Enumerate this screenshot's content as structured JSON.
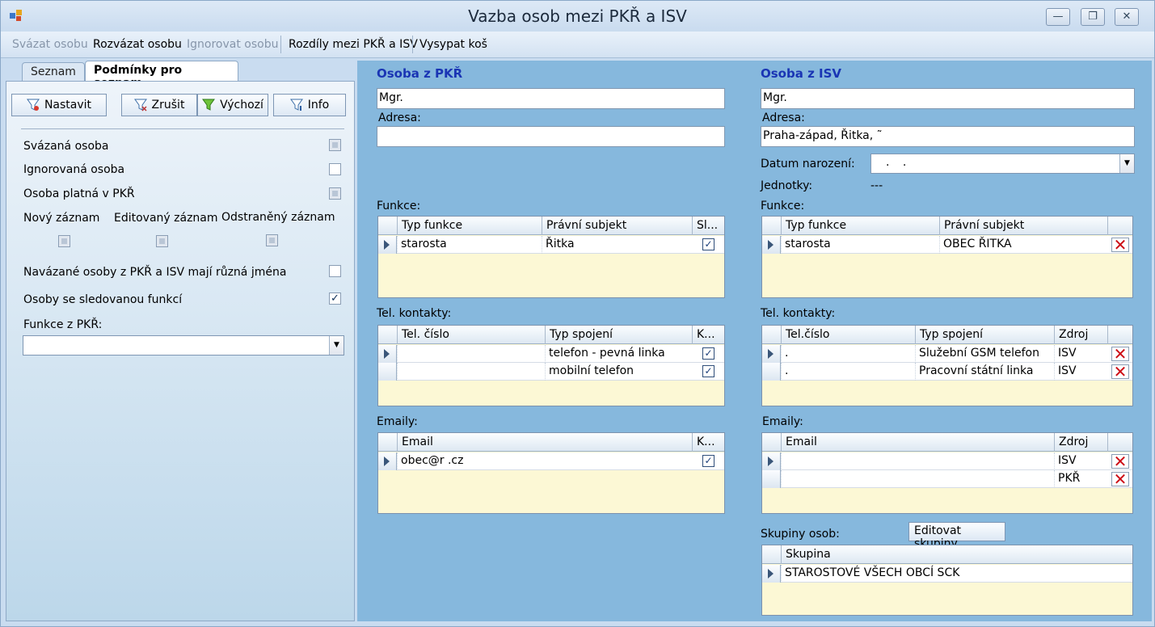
{
  "window": {
    "title": "Vazba osob mezi PKŘ a ISV",
    "minimize": "—",
    "restore": "❐",
    "close": "✕"
  },
  "toolbar": {
    "items": [
      {
        "label": "Svázat osobu",
        "enabled": false
      },
      {
        "label": "Rozvázat osobu",
        "enabled": true
      },
      {
        "label": "Ignorovat osobu",
        "enabled": false
      },
      {
        "label": "Rozdíly mezi PKŘ a ISV",
        "enabled": true
      },
      {
        "label": "Vysypat koš",
        "enabled": true
      }
    ]
  },
  "left": {
    "tabs": [
      {
        "label": "Seznam",
        "active": false
      },
      {
        "label": "Podmínky pro seznam",
        "active": true
      }
    ],
    "filter_buttons": [
      "Nastavit",
      "Zrušit",
      "Výchozí",
      "Info"
    ],
    "conditions": {
      "svazana": {
        "label": "Svázaná osoba",
        "state": "indeterminate"
      },
      "ignorovana": {
        "label": "Ignorovaná osoba",
        "state": "unchecked"
      },
      "platna": {
        "label": "Osoba platná v PKŘ",
        "state": "indeterminate"
      },
      "novy": {
        "label": "Nový záznam",
        "state": "indeterminate"
      },
      "editovany": {
        "label": "Editovaný záznam",
        "state": "indeterminate"
      },
      "odstraneny": {
        "label": "Odstraněný záznam",
        "state": "indeterminate"
      },
      "ruzna_jmena": {
        "label": "Navázané osoby z PKŘ a ISV mají různá jména",
        "state": "unchecked"
      },
      "sledovana": {
        "label": "Osoby se sledovanou funkcí",
        "state": "checked"
      }
    },
    "funkce_label": "Funkce z PKŘ:",
    "funkce_value": ""
  },
  "pkr": {
    "header": "Osoba z PKŘ",
    "name": "Mgr. ",
    "adresa_label": "Adresa:",
    "adresa": "",
    "funkce_label": "Funkce:",
    "funkce_cols": [
      "Typ funkce",
      "Právní subjekt",
      "Sl..."
    ],
    "funkce_rows": [
      {
        "typ": "starosta",
        "subjekt": "Řitka",
        "checked": "✓"
      }
    ],
    "tel_label": "Tel. kontakty:",
    "tel_cols": [
      "Tel. číslo",
      "Typ spojení",
      "K..."
    ],
    "tel_rows": [
      {
        "cislo": "",
        "typ": "telefon - pevná linka",
        "checked": "✓"
      },
      {
        "cislo": "",
        "typ": "mobilní telefon",
        "checked": "✓"
      }
    ],
    "email_label": "Emaily:",
    "email_cols": [
      "Email",
      "K..."
    ],
    "email_rows": [
      {
        "email": "obec@r       .cz",
        "checked": "✓"
      }
    ]
  },
  "isv": {
    "header": "Osoba z ISV",
    "name": "Mgr.",
    "adresa_label": "Adresa:",
    "adresa": "Praha-západ, Řitka, ˜",
    "datum_label": "Datum narození:",
    "datum_value": ".   .",
    "jednotky_label": "Jednotky:",
    "jednotky_value": "---",
    "funkce_label": "Funkce:",
    "funkce_cols": [
      "Typ funkce",
      "Právní subjekt",
      ""
    ],
    "funkce_rows": [
      {
        "typ": "starosta",
        "subjekt": "OBEC ŘITKA"
      }
    ],
    "tel_label": "Tel. kontakty:",
    "tel_cols": [
      "Tel.číslo",
      "Typ spojení",
      "Zdroj",
      ""
    ],
    "tel_rows": [
      {
        "cislo": ".",
        "typ": "Služební GSM telefon",
        "zdroj": "ISV"
      },
      {
        "cislo": ".",
        "typ": "Pracovní státní linka",
        "zdroj": "ISV"
      }
    ],
    "email_label": "Emaily:",
    "email_cols": [
      "Email",
      "Zdroj",
      ""
    ],
    "email_rows": [
      {
        "email": "",
        "zdroj": "ISV"
      },
      {
        "email": "",
        "zdroj": "PKŘ"
      }
    ],
    "skupiny_label": "Skupiny osob:",
    "skupiny_button": "Editovat skupiny",
    "skupiny_cols": [
      "Skupina"
    ],
    "skupiny_rows": [
      {
        "skupina": "STAROSTOVÉ VŠECH OBCÍ SCK"
      }
    ],
    "delete_glyph": "✕"
  },
  "colors": {
    "panel_blue": "#86b8dd",
    "header_blue": "#1a35b4",
    "grid_yellow": "#fcf8d5",
    "delete_red": "#cc0b14"
  }
}
